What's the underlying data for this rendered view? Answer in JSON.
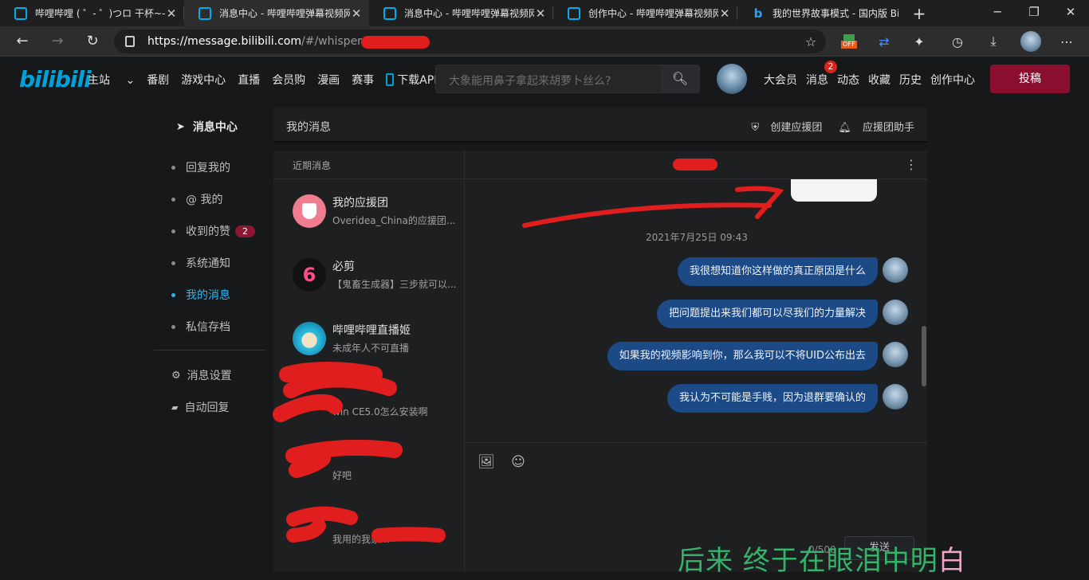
{
  "browser": {
    "tabs": [
      {
        "title": "哔哩哔哩 ( ゜- ゜)つロ 干杯~-bili",
        "icon": "bilibili-tv-icon"
      },
      {
        "title": "消息中心 - 哔哩哔哩弹幕视频网",
        "icon": "bilibili-tv-icon"
      },
      {
        "title": "消息中心 - 哔哩哔哩弹幕视频网",
        "icon": "bilibili-tv-icon"
      },
      {
        "title": "创作中心 - 哔哩哔哩弹幕视频网",
        "icon": "bilibili-tv-icon"
      },
      {
        "title": "我的世界故事模式 - 国内版 Bing",
        "icon": "bing-icon"
      }
    ],
    "url_host": "https://message.bilibili.com",
    "url_path": "/#/whisper/mid",
    "extension_badge": "OFF"
  },
  "header": {
    "logo": "bilibili",
    "nav_left": [
      "主站",
      "番剧",
      "游戏中心",
      "直播",
      "会员购",
      "漫画",
      "赛事",
      "下载APP"
    ],
    "search_placeholder": "大象能用鼻子拿起来胡萝卜丝么?",
    "nav_right": [
      "大会员",
      "消息",
      "动态",
      "收藏",
      "历史",
      "创作中心"
    ],
    "message_badge": "2",
    "upload_label": "投稿"
  },
  "sidebar": {
    "title": "消息中心",
    "items": [
      "回复我的",
      "@ 我的",
      "收到的赞",
      "系统通知",
      "我的消息",
      "私信存档"
    ],
    "likes_badge": "2",
    "settings": [
      "消息设置",
      "自动回复"
    ]
  },
  "topbar": {
    "title": "我的消息",
    "create_group": "创建应援团",
    "group_helper": "应援团助手"
  },
  "conversations": {
    "header": "近期消息",
    "items": [
      {
        "name": "我的应援团",
        "preview": "Overidea_China的应援团..."
      },
      {
        "name": "必剪",
        "preview": "【鬼畜生成器】三步就可以..."
      },
      {
        "name": "哔哩哔哩直播姬",
        "preview": "未成年人不可直播"
      },
      {
        "name": "",
        "preview": "win CE5.0怎么安装啊"
      },
      {
        "name": "",
        "preview": "好吧"
      },
      {
        "name": "",
        "preview": "我用的我家…"
      }
    ]
  },
  "chat": {
    "timestamp": "2021年7月25日 09:43",
    "messages": [
      "我很想知道你这样做的真正原因是什么",
      "把问题提出来我们都可以尽我们的力量解决",
      "如果我的视频影响到你，那么我可以不将UID公布出去",
      "我认为不可能是手贱，因为退群要确认的"
    ],
    "char_count": "0/500",
    "send_label": "发送"
  },
  "caption": {
    "main": "后来 终于在眼泪中明",
    "last": "白"
  },
  "colors": {
    "accent": "#00a1d6",
    "bubble": "#1c4a86",
    "upload": "#8a0f2f",
    "caption": "#36b36a",
    "redaction": "#e01e1e"
  }
}
